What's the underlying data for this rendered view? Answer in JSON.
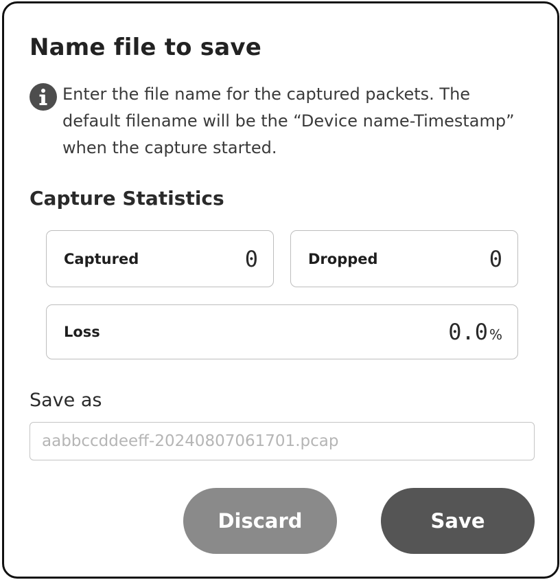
{
  "dialog": {
    "title": "Name file to save",
    "info": {
      "icon": "info-icon",
      "text": "Enter the file name for the captured packets. The default filename will be the “Device name-Timestamp” when the capture started."
    }
  },
  "statistics": {
    "title": "Capture Statistics",
    "captured": {
      "label": "Captured",
      "value": "0"
    },
    "dropped": {
      "label": "Dropped",
      "value": "0"
    },
    "loss": {
      "label": "Loss",
      "value": "0.0",
      "unit": "%"
    }
  },
  "save_as": {
    "label": "Save as",
    "value": "",
    "placeholder": "aabbccddeeff-20240807061701.pcap"
  },
  "buttons": {
    "discard_label": "Discard",
    "save_label": "Save"
  },
  "colors": {
    "discard_button": "#8a8a8a",
    "save_button": "#555555",
    "border": "#111111"
  }
}
